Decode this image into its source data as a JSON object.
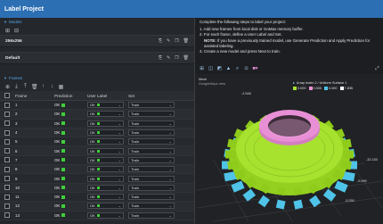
{
  "window": {
    "title": "Label Project"
  },
  "models": {
    "section_label": "Models",
    "toolbar_icons": [
      "add-model-icon",
      "delete-model-icon"
    ],
    "items": [
      {
        "name": "256x256",
        "icons": [
          "copy-icon",
          "edit-icon",
          "duplicate-icon",
          "delete-icon"
        ]
      },
      {
        "name": "Default",
        "icons": [
          "copy-icon",
          "edit-icon",
          "duplicate-icon",
          "delete-icon"
        ]
      }
    ]
  },
  "frames": {
    "section_label": "Frames",
    "toolbar_icons": [
      "add-frame-icon",
      "import-icon",
      "export-icon",
      "delete-frame-icon",
      "up-icon",
      "down-icon",
      "grid-icon"
    ],
    "columns": {
      "frame": "Frame",
      "prediction": "Prediction",
      "user_label": "User Label",
      "set": "Set"
    },
    "rows": [
      {
        "frame": "1",
        "prediction": "OK",
        "user_label": "OK",
        "set": "Train"
      },
      {
        "frame": "2",
        "prediction": "OK",
        "user_label": "OK",
        "set": "Train"
      },
      {
        "frame": "3",
        "prediction": "OK",
        "user_label": "OK",
        "set": "Train"
      },
      {
        "frame": "4",
        "prediction": "OK",
        "user_label": "OK",
        "set": "Train"
      },
      {
        "frame": "5",
        "prediction": "OK",
        "user_label": "OK",
        "set": "Train"
      },
      {
        "frame": "6",
        "prediction": "OK",
        "user_label": "OK",
        "set": "Train"
      },
      {
        "frame": "7",
        "prediction": "OK",
        "user_label": "OK",
        "set": "Train"
      },
      {
        "frame": "8",
        "prediction": "OK",
        "user_label": "OK",
        "set": "Train"
      },
      {
        "frame": "9",
        "prediction": "OK",
        "user_label": "OK",
        "set": "Train"
      },
      {
        "frame": "10",
        "prediction": "OK",
        "user_label": "OK",
        "set": "Train"
      },
      {
        "frame": "11",
        "prediction": "OK",
        "user_label": "OK",
        "set": "Train"
      },
      {
        "frame": "12",
        "prediction": "OK",
        "user_label": "OK",
        "set": "Train"
      },
      {
        "frame": "13",
        "prediction": "OK",
        "user_label": "OK",
        "set": "Train"
      }
    ]
  },
  "instructions": {
    "intro": "Complete the following steps to label your project:",
    "step1": "1. Add new frames from local disk or GoMax memory buffer.",
    "step2": "2. For each frame, define a User Label and Set.",
    "note_label": "NOTE:",
    "note_text": "If you have a previously trained model, use Generate Prediction and Apply Prediction for assisted labeling.",
    "step3": "3. Create a new model and press Next to train."
  },
  "viewer": {
    "toolbar_icons": [
      "grid-view-icon",
      "layers-icon",
      "3d-view-icon",
      "surface-icon",
      "search-icon",
      "target-icon",
      "color-map-icon"
    ],
    "overlay_title": "Mesh",
    "overlay_subtitle": "GoogleMaps view",
    "legend_title": "Array Index 2 / Uniform Surface 1",
    "legend_values": [
      "0.000",
      "0.000",
      "0.000",
      "7.835"
    ],
    "axis_labels": [
      "-2.546",
      "-32.150",
      "-0.990",
      "-3.250"
    ],
    "colors": {
      "green": "#a6e22e",
      "pink": "#e88fd5",
      "cyan": "#4fc3e8"
    }
  },
  "colors": {
    "titlebar": "#2d6fb3",
    "ok_indicator": "#3fcf3a",
    "section_header": "#55a6e8"
  }
}
